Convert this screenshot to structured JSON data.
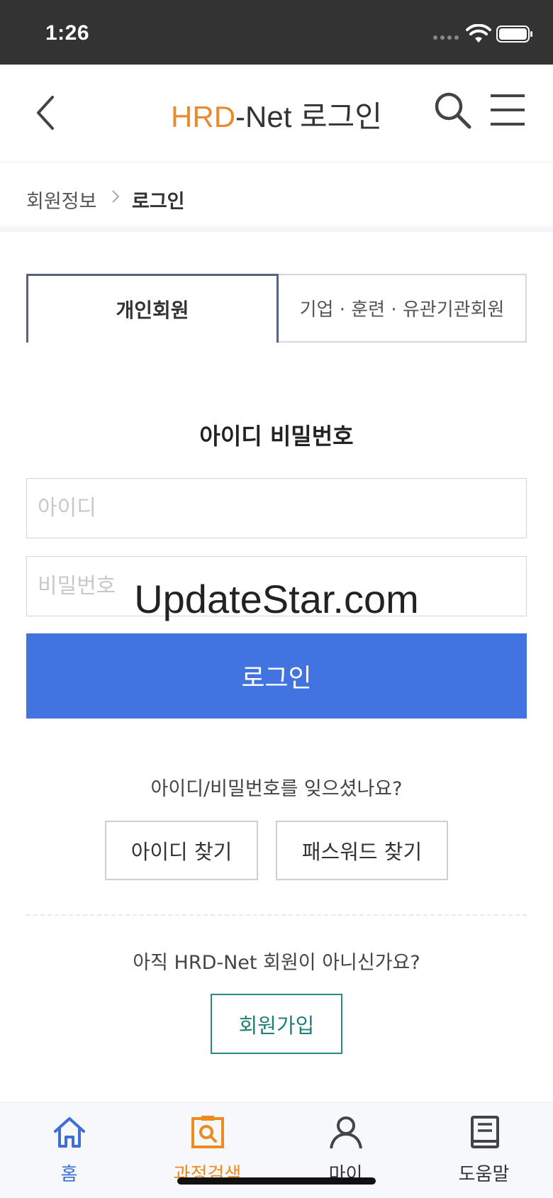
{
  "status_bar": {
    "time": "1:26",
    "wifi_icon": "wifi-icon",
    "battery_icon": "battery-icon"
  },
  "header": {
    "brand": "HRD",
    "title_rest": "-Net 로그인",
    "brand_color": "#e98a2d",
    "back_icon": "chevron-left-icon",
    "search_icon": "search-icon",
    "menu_icon": "hamburger-menu-icon"
  },
  "breadcrumb": {
    "home": "회원정보",
    "current": "로그인"
  },
  "tabs": [
    {
      "label": "개인회원",
      "active": true
    },
    {
      "label": "기업 · 훈련 · 유관기관회원",
      "active": false
    }
  ],
  "login_form": {
    "section_title": "아이디 비밀번호",
    "id_placeholder": "아이디",
    "id_value": "",
    "pw_placeholder": "비밀번호",
    "pw_value": "",
    "submit_label": "로그인",
    "submit_color": "#4274e1"
  },
  "watermark": "UpdateStar.com",
  "recovery": {
    "prompt": "아이디/비밀번호를 잊으셨나요?",
    "find_id_label": "아이디 찾기",
    "find_pw_label": "패스워드 찾기"
  },
  "signup": {
    "prompt": "아직 HRD-Net 회원이 아니신가요?",
    "button_label": "회원가입",
    "accent_color": "#2a8a84"
  },
  "bottom_nav": [
    {
      "label": "홈",
      "icon": "home-icon",
      "color": "#3d6fd6"
    },
    {
      "label": "과정검색",
      "icon": "course-search-icon",
      "color": "#ef8a1f"
    },
    {
      "label": "마이",
      "icon": "user-icon",
      "color": "#333333"
    },
    {
      "label": "도움말",
      "icon": "help-book-icon",
      "color": "#333333"
    }
  ]
}
